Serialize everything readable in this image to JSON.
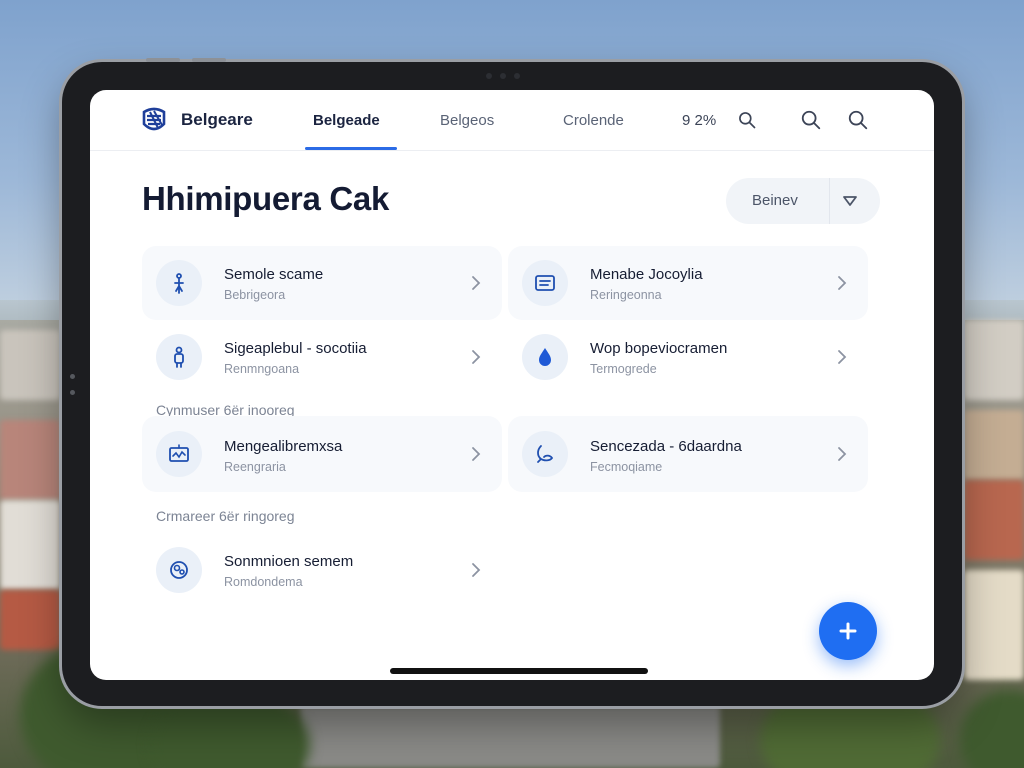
{
  "header": {
    "brand": "Belgeare",
    "tabs": [
      {
        "label": "Belgeade",
        "active": true
      },
      {
        "label": "Belgeos",
        "active": false
      },
      {
        "label": "Crolende",
        "active": false
      }
    ],
    "battery": "9 2%",
    "icons": [
      "search-icon",
      "search-icon",
      "search-icon"
    ]
  },
  "main": {
    "title": "Hhimipuera Cak",
    "select": {
      "value": "Beinev",
      "icon": "chevron-down-icon"
    },
    "section_labels": [
      "Cynmuser 6ër inooreg",
      "Crmareer 6ër ringoreg"
    ],
    "items": [
      {
        "title": "Semole scame",
        "subtitle": "Bebrigeora",
        "icon": "tool-icon"
      },
      {
        "title": "Menabe Jocoylia",
        "subtitle": "Reringeonna",
        "icon": "document-icon"
      },
      {
        "title": "Sigeaplebul - socotiia",
        "subtitle": "Renmngoana",
        "icon": "person-icon"
      },
      {
        "title": "Wop bopeviocramen",
        "subtitle": "Termogrede",
        "icon": "drop-icon"
      },
      {
        "title": "Mengealibremxsa",
        "subtitle": "Reengraria",
        "icon": "chart-board-icon"
      },
      {
        "title": "Sencezada - 6daardna",
        "subtitle": "Fecmoqiame",
        "icon": "leaf-icon"
      },
      {
        "title": "Sonmnioen semem",
        "subtitle": "Romdondema",
        "icon": "cluster-icon"
      }
    ]
  },
  "fab": {
    "icon": "plus-icon"
  },
  "colors": {
    "accent": "#1f6ef2",
    "title": "#141b33",
    "card_bg": "#f7f9fc",
    "icon_stroke": "#1f4fb0"
  }
}
